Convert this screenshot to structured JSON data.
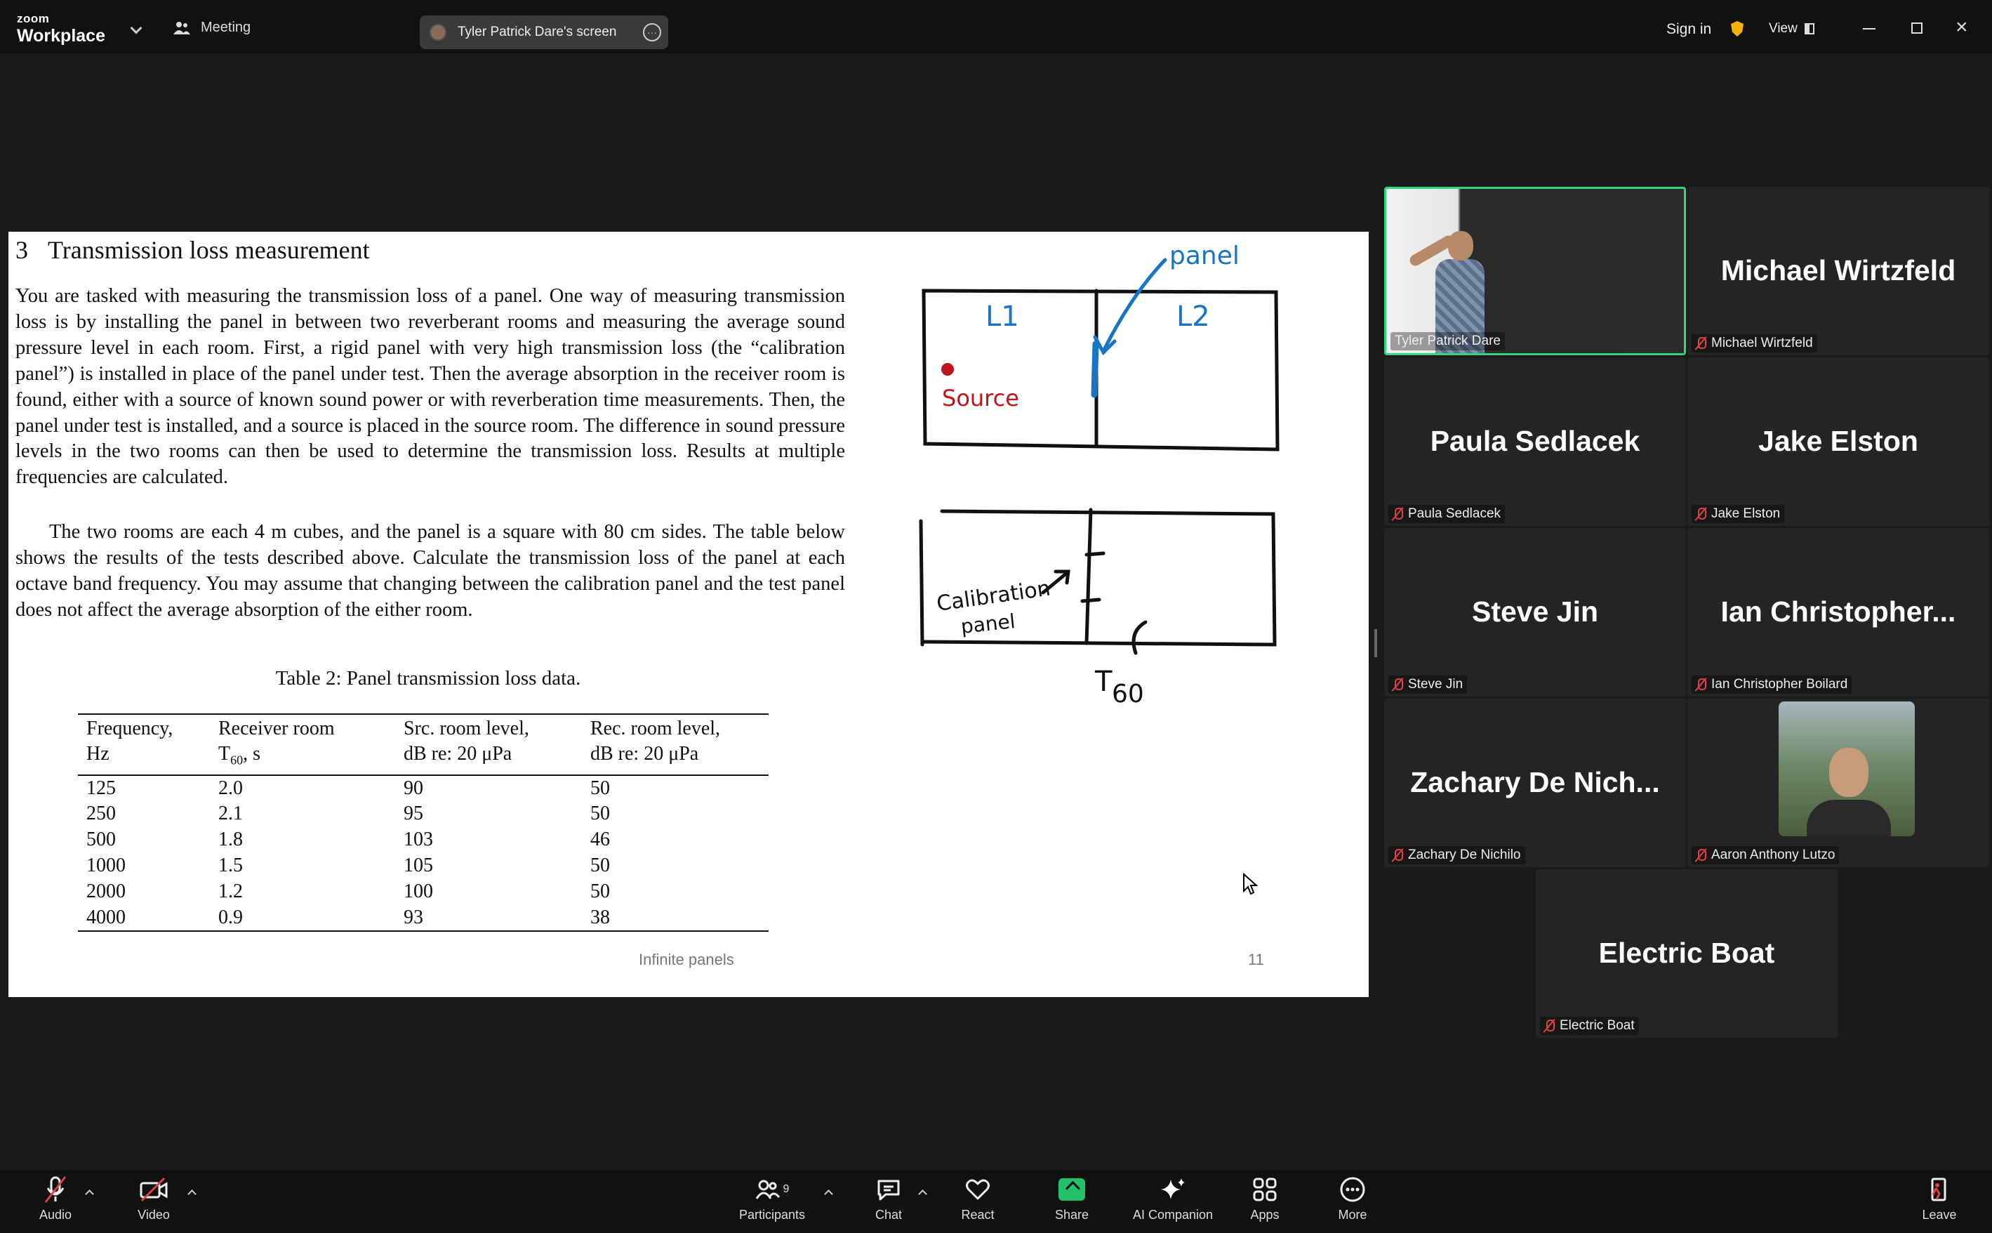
{
  "app": {
    "brand_small": "zoom",
    "brand_big": "Workplace",
    "meeting_label": "Meeting",
    "share_pill_label": "Tyler Patrick Dare's screen",
    "signin_label": "Sign in",
    "view_label": "View"
  },
  "slide": {
    "section_number": "3",
    "section_title": "Transmission loss measurement",
    "para1": "You are tasked with measuring the transmission loss of a panel. One way of measuring transmission loss is by installing the panel in between two reverberant rooms and measuring the average sound pressure level in each room. First, a rigid panel with very high transmission loss (the “calibration panel”) is installed in place of the panel under test. Then the average absorption in the receiver room is found, either with a source of known sound power or with reverberation time measurements. Then, the panel under test is installed, and a source is placed in the source room. The difference in sound pressure levels in the two rooms can then be used to determine the transmission loss. Results at multiple frequencies are calculated.",
    "para2": "The two rooms are each 4 m cubes, and the panel is a square with 80 cm sides. The table below shows the results of the tests described above. Calculate the transmission loss of the panel at each octave band frequency. You may assume that changing between the calibration panel and the test panel does not affect the average absorption of the either room.",
    "table_caption": "Table 2: Panel transmission loss data.",
    "table_headers": [
      [
        "Frequency,",
        "Hz"
      ],
      [
        "Receiver room",
        "T",
        "60",
        ", s"
      ],
      [
        "Src. room level,",
        "dB re: 20 μPa"
      ],
      [
        "Rec. room level,",
        "dB re: 20 μPa"
      ]
    ],
    "table_rows": [
      [
        "125",
        "2.0",
        "90",
        "50"
      ],
      [
        "250",
        "2.1",
        "95",
        "50"
      ],
      [
        "500",
        "1.8",
        "103",
        "46"
      ],
      [
        "1000",
        "1.5",
        "105",
        "50"
      ],
      [
        "2000",
        "1.2",
        "100",
        "50"
      ],
      [
        "4000",
        "0.9",
        "93",
        "38"
      ]
    ],
    "footer_left": "Infinite panels",
    "footer_page": "11",
    "annotations": {
      "panel": "panel",
      "l1": "L1",
      "l2": "L2",
      "source": "Source",
      "calibration": "Calibration",
      "calibration2": "panel",
      "t60_t": "T",
      "t60_sub": "60"
    }
  },
  "gallery": [
    {
      "name": "Tyler Patrick Dare",
      "big": "",
      "type": "video"
    },
    {
      "name": "Michael Wirtzfeld",
      "big": "Michael Wirtzfeld"
    },
    {
      "name": "Paula Sedlacek",
      "big": "Paula Sedlacek"
    },
    {
      "name": "Jake Elston",
      "big": "Jake Elston"
    },
    {
      "name": "Steve Jin",
      "big": "Steve Jin"
    },
    {
      "name": "Ian Christopher Boilard",
      "big": "Ian Christopher..."
    },
    {
      "name": "Zachary De Nichilo",
      "big": "Zachary De Nich..."
    },
    {
      "name": "Aaron Anthony Lutzo",
      "big": "",
      "type": "photo"
    },
    {
      "name": "Electric Boat",
      "big": "Electric Boat"
    }
  ],
  "toolbar": {
    "audio": "Audio",
    "video": "Video",
    "participants": "Participants",
    "participants_count": "9",
    "chat": "Chat",
    "react": "React",
    "share": "Share",
    "ai_companion": "AI Companion",
    "apps": "Apps",
    "more": "More",
    "leave": "Leave"
  },
  "colors": {
    "active_speaker": "#2fd67f",
    "muted": "#e04040",
    "share": "#23c16b",
    "annotation_blue": "#1a74c4",
    "annotation_red": "#c0141c"
  }
}
